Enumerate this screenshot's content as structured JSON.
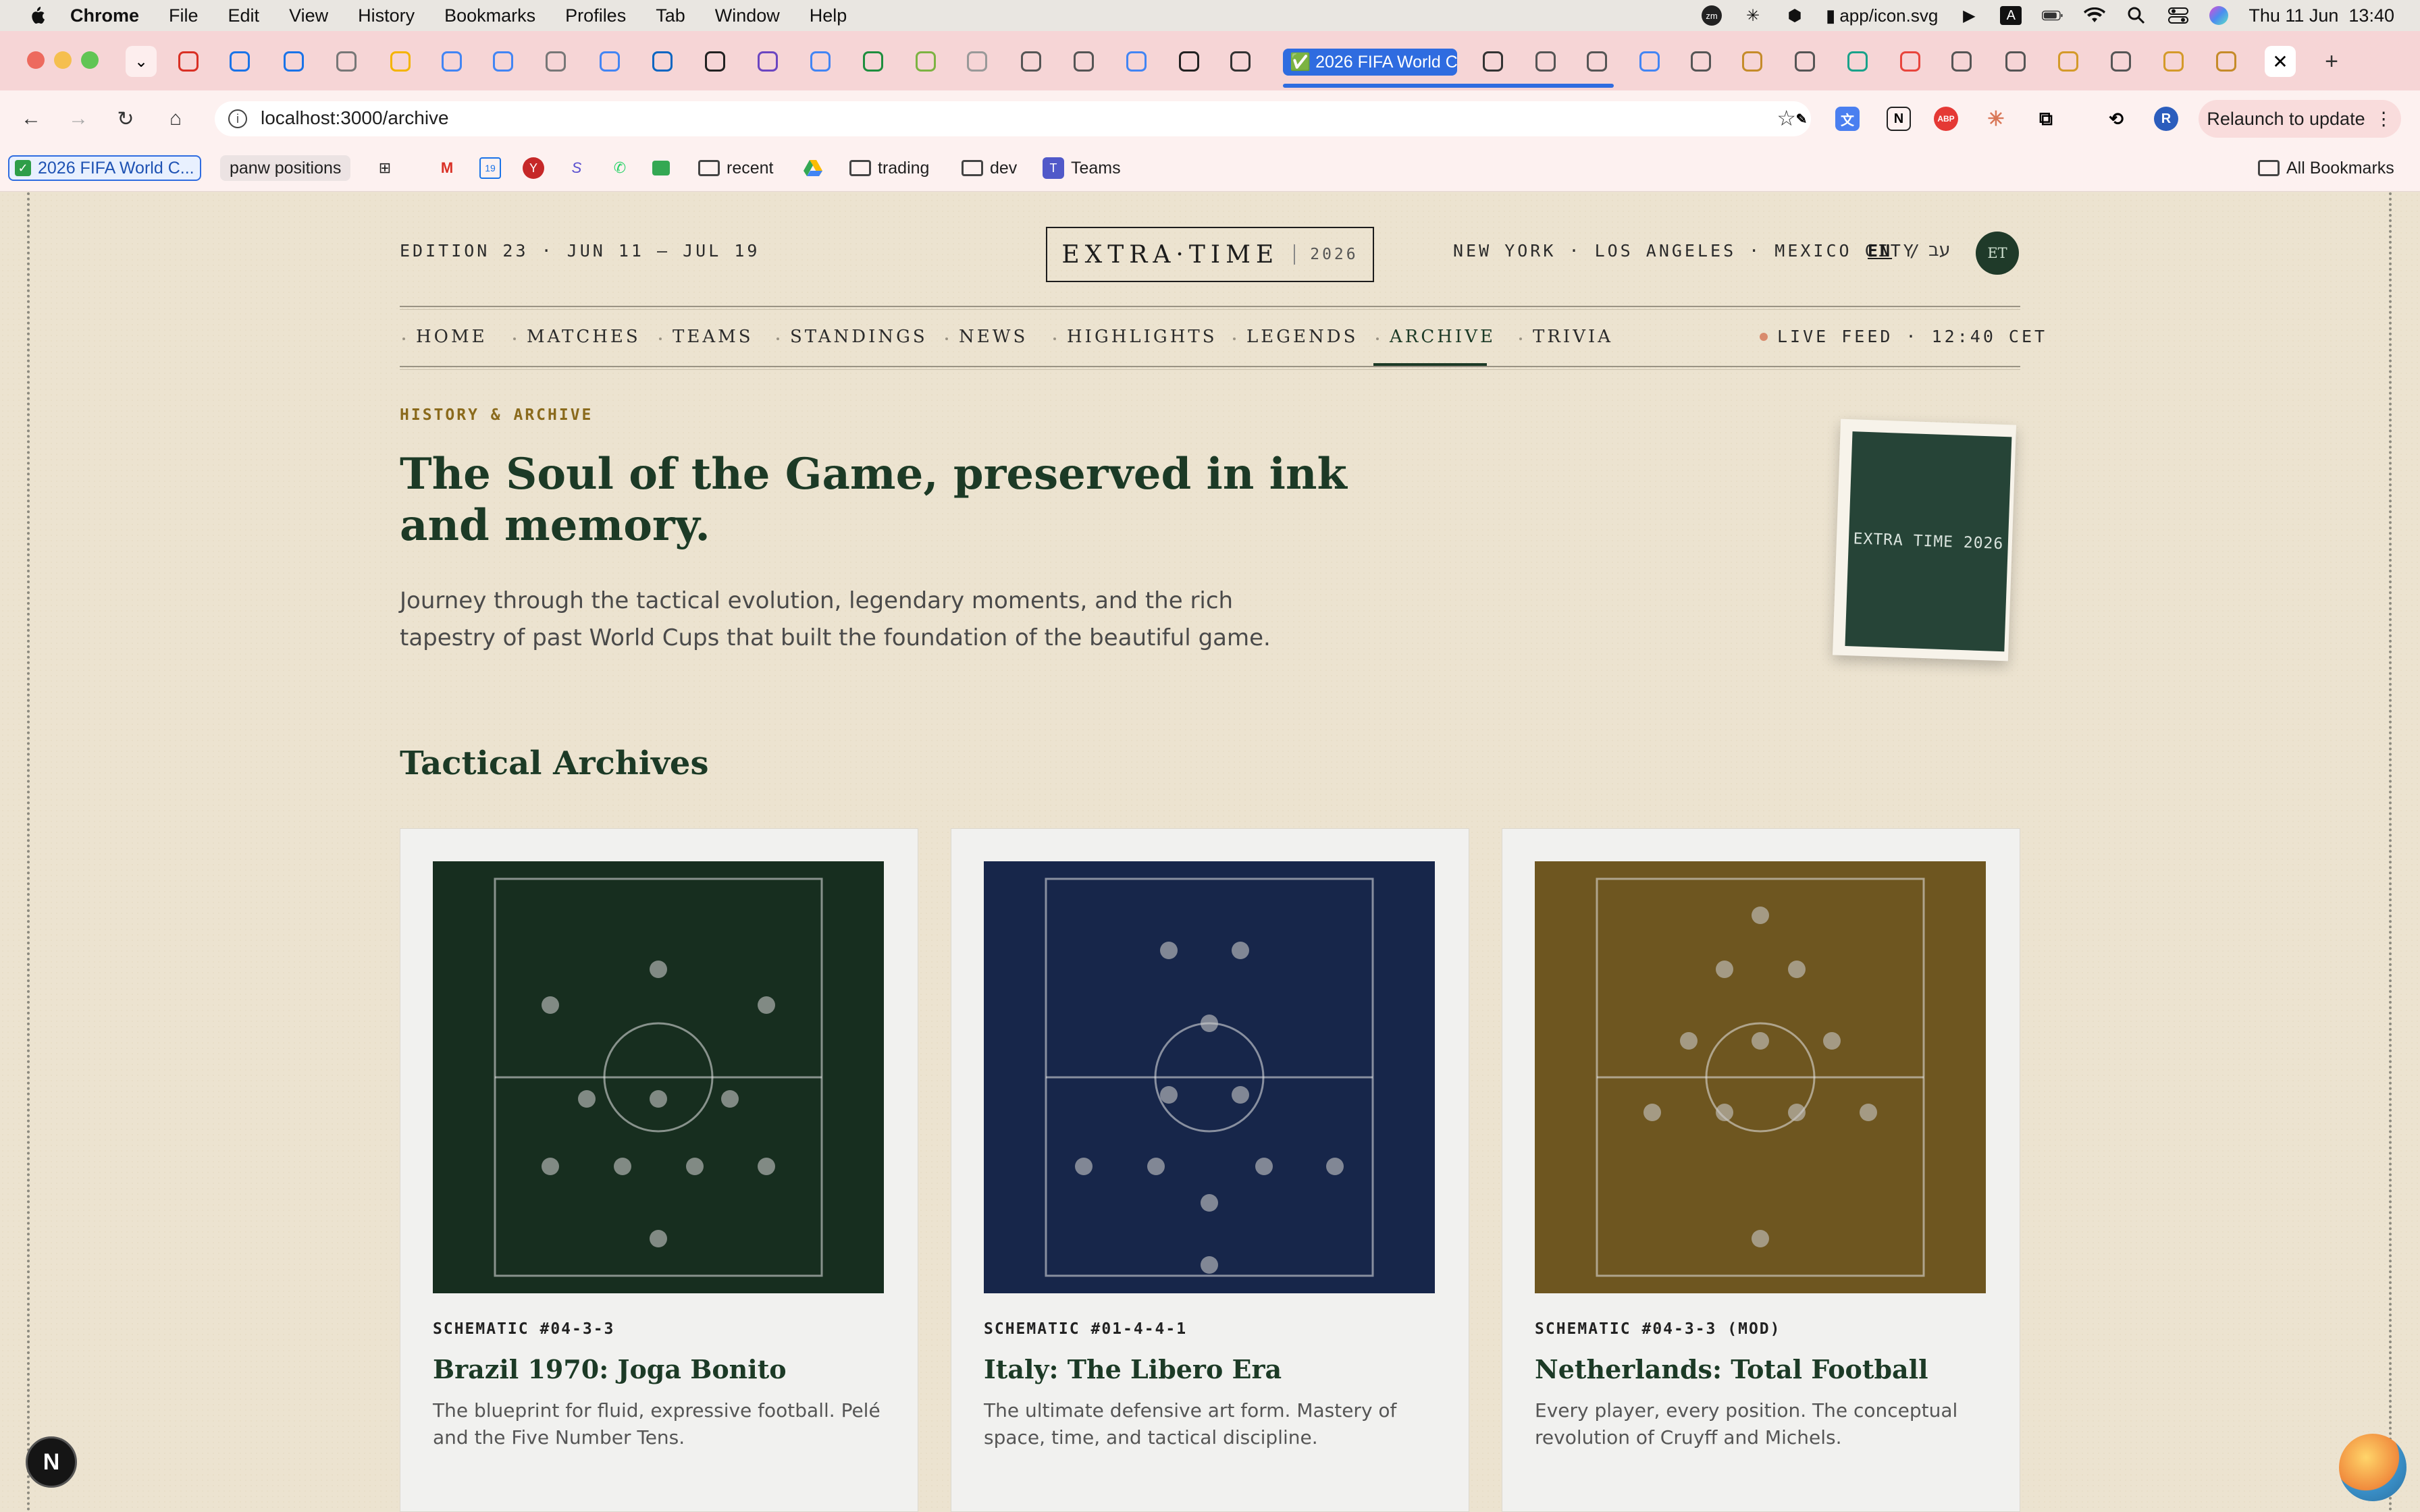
{
  "menubar": {
    "app": "Chrome",
    "items": [
      "File",
      "Edit",
      "View",
      "History",
      "Bookmarks",
      "Profiles",
      "Tab",
      "Window",
      "Help"
    ],
    "status_url": "app/icon.svg",
    "clock": "Thu 11 Jun  13:40"
  },
  "tabs": {
    "active_title": "✅ 2026 FIFA World C",
    "icon_names": [
      "gmail-icon",
      "calendar-icon",
      "calendar-icon",
      "chatgpt-icon",
      "sheets-icon",
      "docs-icon",
      "docs-icon",
      "chatgpt-icon",
      "docs-icon",
      "linkedin-icon",
      "apps-icon",
      "tool-icon",
      "google-icon",
      "whatsapp-icon",
      "tool-icon",
      "chatgpt-icon",
      "perplexity-icon",
      "globe-icon",
      "docs-icon",
      "openai-icon",
      "wikipedia-icon"
    ]
  },
  "toolbar": {
    "url": "localhost:3000/archive",
    "relaunch_label": "Relaunch to update"
  },
  "bookmarks": {
    "items": [
      "2026 FIFA World C...",
      "panw positions",
      "recent",
      "trading",
      "dev",
      "Teams"
    ],
    "all_label": "All Bookmarks"
  },
  "site": {
    "edition": "EDITION 23 · JUN 11 — JUL 19",
    "logo_name": "EXTRA·TIME",
    "logo_year": "2026",
    "cities": "NEW YORK · LOS ANGELES · MEXICO CITY",
    "lang_en": "EN",
    "lang_sep": "/",
    "lang_he": "עב",
    "avatar": "ET",
    "nav": [
      "HOME",
      "MATCHES",
      "TEAMS",
      "STANDINGS",
      "NEWS",
      "HIGHLIGHTS",
      "LEGENDS",
      "ARCHIVE",
      "TRIVIA"
    ],
    "nav_active": "ARCHIVE",
    "live": "LIVE FEED · 12:40 CET"
  },
  "hero": {
    "eyebrow": "HISTORY & ARCHIVE",
    "title": "The Soul of the Game, preserved in ink and memory.",
    "description": "Journey through the tactical evolution, legendary moments, and the rich tapestry of past World Cups that built the foundation of the beautiful game.",
    "poster_text": "EXTRA TIME 2026"
  },
  "archives": {
    "title": "Tactical Archives",
    "cards": [
      {
        "code": "SCHEMATIC #04-3-3",
        "title": "Brazil 1970: Joga Bonito",
        "desc": "The blueprint for fluid, expressive football. Pelé and the Five Number Tens.",
        "color": "#172e1f"
      },
      {
        "code": "SCHEMATIC #01-4-4-1",
        "title": "Italy: The Libero Era",
        "desc": "The ultimate defensive art form. Mastery of space, time, and tactical discipline.",
        "color": "#17264a"
      },
      {
        "code": "SCHEMATIC #04-3-3 (MOD)",
        "title": "Netherlands: Total Football",
        "desc": "Every player, every position. The conceptual revolution of Cruyff and Michels.",
        "color": "#6e5620"
      }
    ]
  }
}
